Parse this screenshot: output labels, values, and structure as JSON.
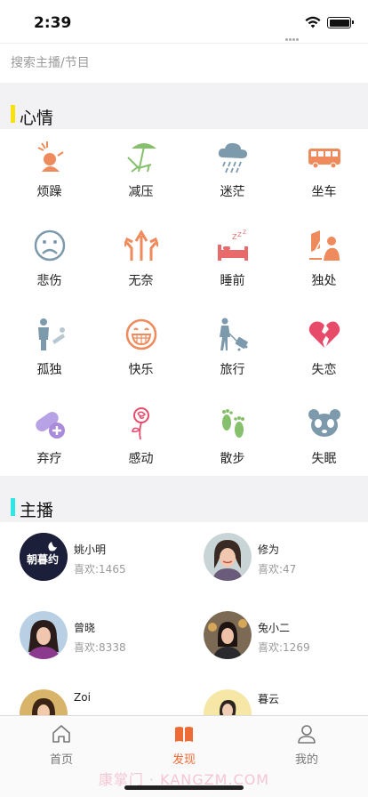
{
  "status": {
    "time": "2:39"
  },
  "search": {
    "placeholder": "搜索主播/节目"
  },
  "mood_section": {
    "title": "心情",
    "accent": "#f7e10f",
    "items": [
      {
        "label": "烦躁",
        "icon": "irritated-person-icon",
        "color": "#ee8a5b"
      },
      {
        "label": "减压",
        "icon": "beach-chair-icon",
        "color": "#86c06c"
      },
      {
        "label": "迷茫",
        "icon": "rain-cloud-icon",
        "color": "#7d9aad"
      },
      {
        "label": "坐车",
        "icon": "bus-icon",
        "color": "#ee8a5b"
      },
      {
        "label": "悲伤",
        "icon": "sad-face-icon",
        "color": "#7d9aad"
      },
      {
        "label": "无奈",
        "icon": "arrows-up-icon",
        "color": "#ee8a5b"
      },
      {
        "label": "睡前",
        "icon": "bed-zzz-icon",
        "color": "#e86a6a"
      },
      {
        "label": "独处",
        "icon": "person-window-icon",
        "color": "#ee8a5b"
      },
      {
        "label": "孤独",
        "icon": "lonely-person-icon",
        "color": "#7d9aad"
      },
      {
        "label": "快乐",
        "icon": "grin-face-icon",
        "color": "#ee8a5b"
      },
      {
        "label": "旅行",
        "icon": "traveler-suitcase-icon",
        "color": "#7d9aad"
      },
      {
        "label": "失恋",
        "icon": "broken-heart-icon",
        "color": "#e84a6a"
      },
      {
        "label": "弃疗",
        "icon": "pill-icon",
        "color": "#a98adb"
      },
      {
        "label": "感动",
        "icon": "rose-icon",
        "color": "#e84a6a"
      },
      {
        "label": "散步",
        "icon": "footprints-icon",
        "color": "#86c06c"
      },
      {
        "label": "失眠",
        "icon": "panda-icon",
        "color": "#7d9aad"
      }
    ]
  },
  "host_section": {
    "title": "主播",
    "accent": "#2ee6e6",
    "hosts": [
      {
        "name": "姚小明",
        "likes": "喜欢:1465",
        "avatar": "night-logo-avatar"
      },
      {
        "name": "修为",
        "likes": "喜欢:47",
        "avatar": "woman-photo-avatar"
      },
      {
        "name": "曾晓",
        "likes": "喜欢:8338",
        "avatar": "woman-photo-avatar"
      },
      {
        "name": "兔小二",
        "likes": "喜欢:1269",
        "avatar": "woman-photo-avatar"
      },
      {
        "name": "Zoi",
        "likes": "",
        "avatar": "woman-photo-avatar"
      },
      {
        "name": "暮云",
        "likes": "",
        "avatar": "woman-photo-avatar"
      }
    ]
  },
  "tabs": [
    {
      "label": "首页",
      "icon": "home-icon",
      "active": false
    },
    {
      "label": "发现",
      "icon": "open-book-icon",
      "active": true
    },
    {
      "label": "我的",
      "icon": "user-icon",
      "active": false
    }
  ],
  "watermark": "康掌门 · KANGZM.COM"
}
